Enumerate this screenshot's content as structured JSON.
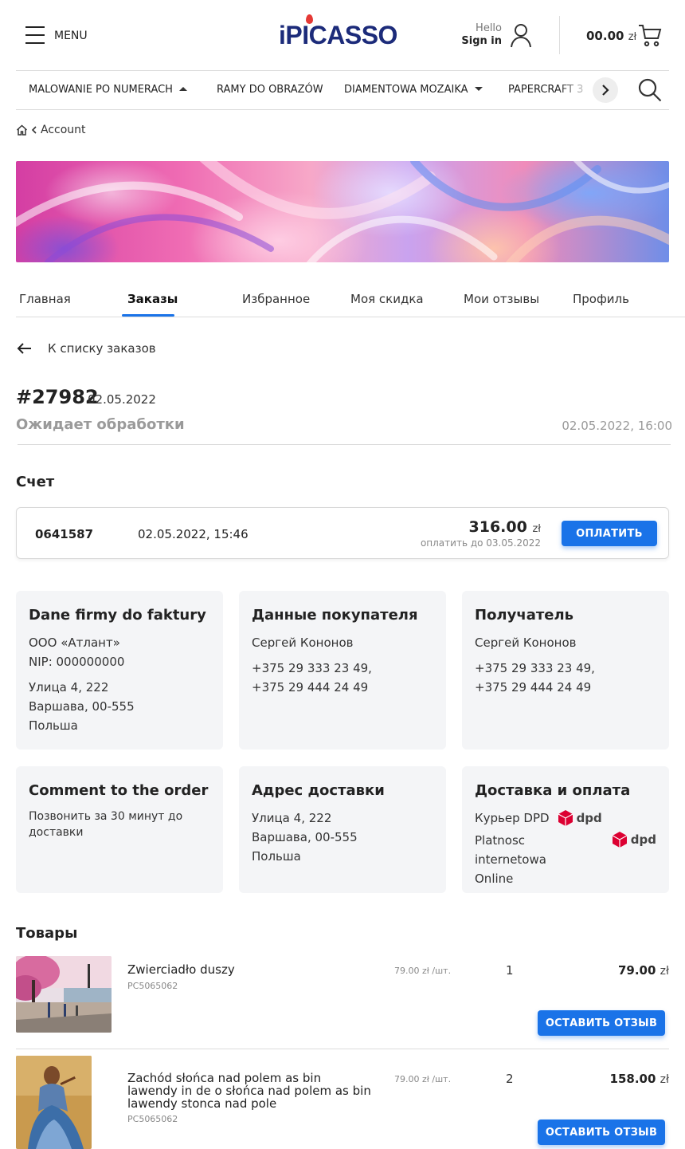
{
  "header": {
    "menu_label": "MENU",
    "logo_text": "iPICASSO",
    "hello": "Hello",
    "sign_in": "Sign in",
    "cart_amount": "00.00",
    "cart_currency": "zł"
  },
  "nav": {
    "items": [
      {
        "label": "MALOWANIE PO NUMERACH"
      },
      {
        "label": "RAMY DO OBRAZÓW"
      },
      {
        "label": "DIAMENTOWA MOZAIKA"
      },
      {
        "label": "PAPERCRAFT 3"
      }
    ]
  },
  "breadcrumb": {
    "label": "Account"
  },
  "tabs": [
    {
      "label": "Главная"
    },
    {
      "label": "Заказы"
    },
    {
      "label": "Избранное"
    },
    {
      "label": "Моя скидка"
    },
    {
      "label": "Мои отзывы"
    },
    {
      "label": "Профиль"
    }
  ],
  "back_label": "К списку заказов",
  "order": {
    "number": "#27982",
    "date": "02.05.2022",
    "status": "Ожидает обработки",
    "datetime": "02.05.2022, 16:00"
  },
  "invoice": {
    "title": "Счет",
    "number": "0641587",
    "date": "02.05.2022, 15:46",
    "amount": "316.00",
    "currency": "zł",
    "due": "оплатить до 03.05.2022",
    "pay_label": "ОПЛАТИТЬ"
  },
  "cards": {
    "company": {
      "title": "Dane firmy do faktury",
      "name": "ООО «Атлант»",
      "nip": "NIP: 000000000",
      "street": "Улица 4, 222",
      "city": "Варшава, 00-555",
      "country": "Польша"
    },
    "buyer": {
      "title": "Данные покупателя",
      "name": "Сергей Кононов",
      "phone1": "+375 29 333 23 49,",
      "phone2": "+375 29 444 24 49"
    },
    "recipient": {
      "title": "Получатель",
      "name": "Сергей Кононов",
      "phone1": "+375 29 333 23 49,",
      "phone2": "+375 29 444 24 49"
    },
    "comment": {
      "title": "Comment to the order",
      "text": "Позвонить за 30 минут до доставки"
    },
    "address": {
      "title": "Адрес доставки",
      "street": "Улица 4, 222",
      "city": "Варшава, 00-555",
      "country": "Польша"
    },
    "delivery": {
      "title": "Доставка и оплата",
      "courier": "Курьер DPD",
      "payment_line1": "Platnosc internetowa",
      "payment_line2": "Online",
      "dpd": "dpd"
    }
  },
  "products": {
    "title": "Товары",
    "review_label": "ОСТАВИТЬ ОТЗЫВ",
    "items": [
      {
        "name": "Zwierciadło duszy",
        "sku": "PC5065062",
        "unit_price": "79.00 zł /шт.",
        "qty": "1",
        "total": "79.00",
        "currency": "zł"
      },
      {
        "name": "Zachód słońca nad polem as bin lawendy in de o słońca nad polem as bin lawendy stonca nad pole",
        "sku": "PC5065062",
        "unit_price": "79.00 zł /шт.",
        "qty": "2",
        "total": "158.00",
        "currency": "zł"
      }
    ]
  },
  "colors": {
    "accent": "#1a73e8",
    "logo": "#1c2b7a",
    "dpd": "#dc0032",
    "muted": "#9a9a9a"
  }
}
